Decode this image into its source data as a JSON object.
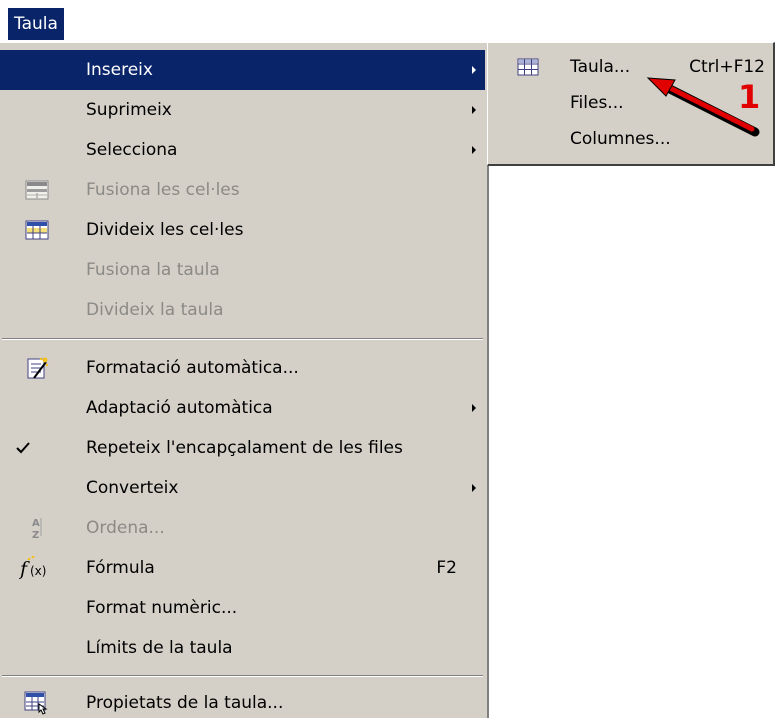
{
  "menubar": {
    "label": "Taula"
  },
  "menu": {
    "items": [
      {
        "label": "Insereix",
        "shortcut": "",
        "submenu": true,
        "state": "selected",
        "icon": ""
      },
      {
        "label": "Suprimeix",
        "shortcut": "",
        "submenu": true,
        "state": "normal",
        "icon": ""
      },
      {
        "label": "Selecciona",
        "shortcut": "",
        "submenu": true,
        "state": "normal",
        "icon": ""
      },
      {
        "label": "Fusiona les cel·les",
        "shortcut": "",
        "submenu": false,
        "state": "disabled",
        "icon": "merge-cells-icon"
      },
      {
        "label": "Divideix les cel·les",
        "shortcut": "",
        "submenu": false,
        "state": "normal",
        "icon": "split-cells-icon"
      },
      {
        "label": "Fusiona la taula",
        "shortcut": "",
        "submenu": false,
        "state": "disabled",
        "icon": ""
      },
      {
        "label": "Divideix la taula",
        "shortcut": "",
        "submenu": false,
        "state": "disabled",
        "icon": ""
      },
      {
        "label": "Formatació automàtica...",
        "shortcut": "",
        "submenu": false,
        "state": "normal",
        "icon": "autoformat-icon"
      },
      {
        "label": "Adaptació automàtica",
        "shortcut": "",
        "submenu": true,
        "state": "normal",
        "icon": ""
      },
      {
        "label": "Repeteix l'encapçalament de les files",
        "shortcut": "",
        "submenu": false,
        "state": "checked",
        "icon": "checkmark-icon"
      },
      {
        "label": "Converteix",
        "shortcut": "",
        "submenu": true,
        "state": "normal",
        "icon": ""
      },
      {
        "label": "Ordena...",
        "shortcut": "",
        "submenu": false,
        "state": "disabled",
        "icon": "sort-az-icon"
      },
      {
        "label": "Fórmula",
        "shortcut": "F2",
        "submenu": false,
        "state": "normal",
        "icon": "formula-fx-icon"
      },
      {
        "label": "Format numèric...",
        "shortcut": "",
        "submenu": false,
        "state": "normal",
        "icon": ""
      },
      {
        "label": "Límits de la taula",
        "shortcut": "",
        "submenu": false,
        "state": "normal",
        "icon": ""
      },
      {
        "label": "Propietats de la taula...",
        "shortcut": "",
        "submenu": false,
        "state": "normal",
        "icon": "table-properties-icon"
      }
    ]
  },
  "submenu": {
    "items": [
      {
        "label": "Taula...",
        "shortcut": "Ctrl+F12",
        "icon": "insert-table-icon"
      },
      {
        "label": "Files...",
        "shortcut": "",
        "icon": ""
      },
      {
        "label": "Columnes...",
        "shortcut": "",
        "icon": ""
      }
    ]
  },
  "annotation": {
    "number": "1",
    "color": "#e00000"
  },
  "colors": {
    "menu_bg": "#d4d0c8",
    "highlight": "#0a246a",
    "disabled_text": "#8c8a85"
  }
}
